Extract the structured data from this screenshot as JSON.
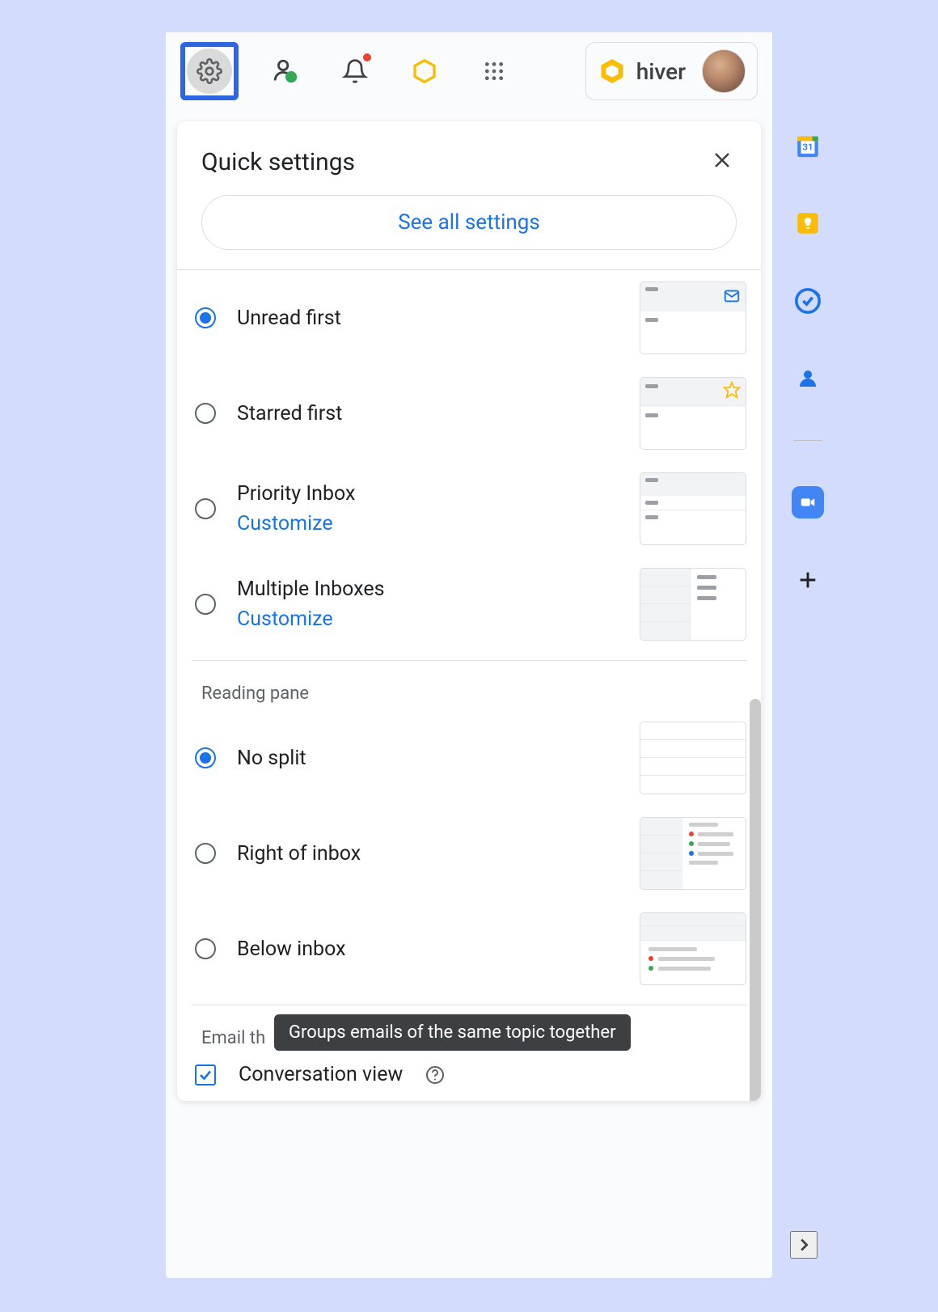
{
  "toolbar": {
    "brand_text": "hiver"
  },
  "quick_settings": {
    "title": "Quick settings",
    "see_all_label": "See all settings",
    "inbox_type": {
      "options": [
        {
          "label": "Unread first",
          "checked": true,
          "has_customize": false
        },
        {
          "label": "Starred first",
          "checked": false,
          "has_customize": false
        },
        {
          "label": "Priority Inbox",
          "checked": false,
          "has_customize": true
        },
        {
          "label": "Multiple Inboxes",
          "checked": false,
          "has_customize": true
        }
      ],
      "customize_label": "Customize"
    },
    "reading_pane": {
      "title": "Reading pane",
      "options": [
        {
          "label": "No split",
          "checked": true
        },
        {
          "label": "Right of inbox",
          "checked": false
        },
        {
          "label": "Below inbox",
          "checked": false
        }
      ]
    },
    "email_threading": {
      "title_partial": "Email th",
      "tooltip": "Groups emails of the same topic together",
      "conversation_view_label": "Conversation view",
      "conversation_view_checked": true
    }
  }
}
